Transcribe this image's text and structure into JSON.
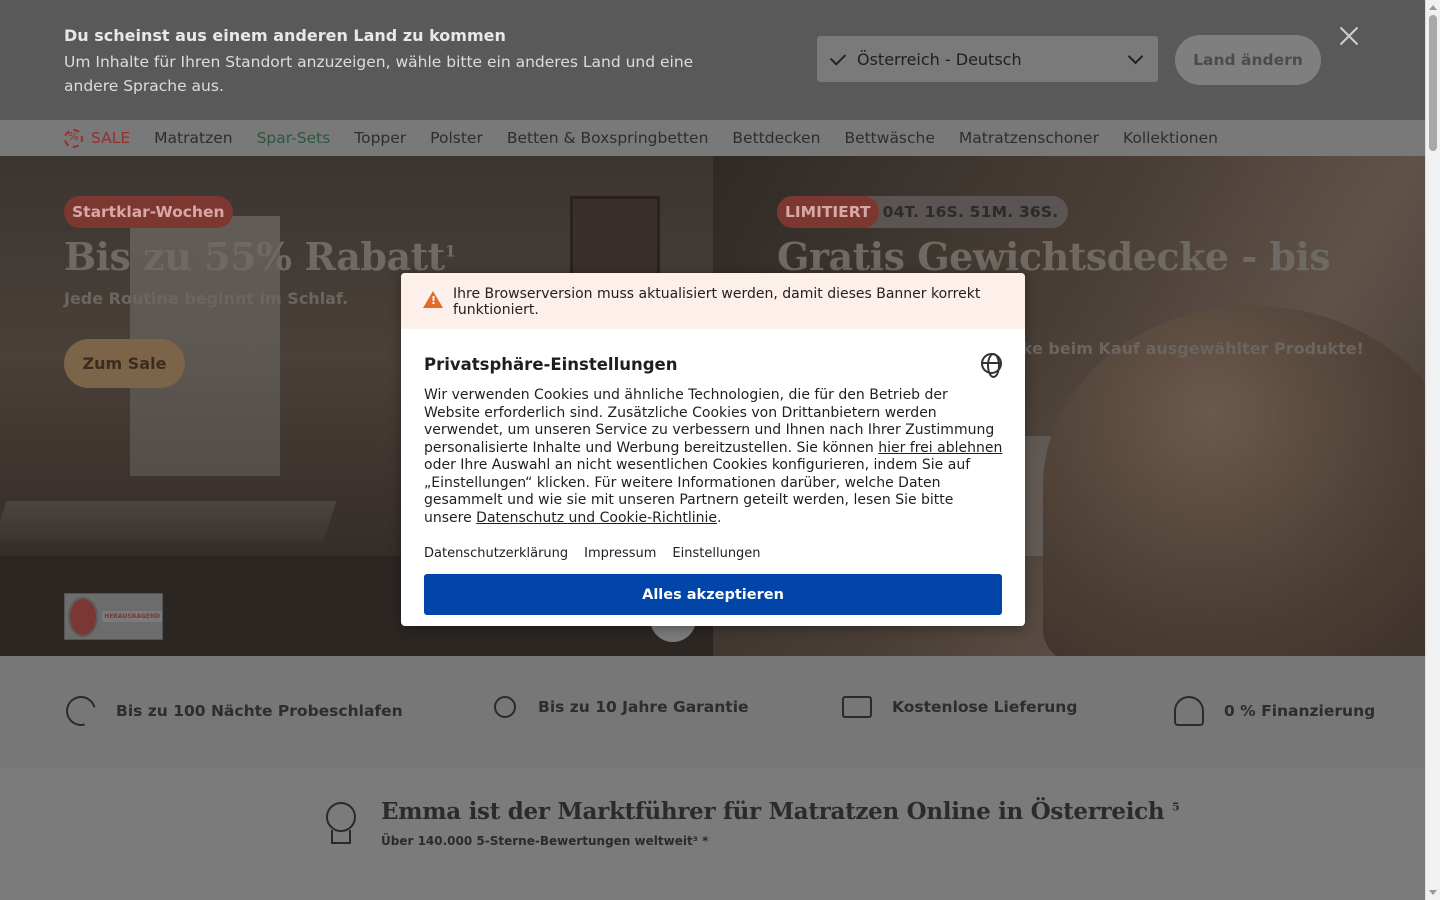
{
  "country_banner": {
    "title": "Du scheinst aus einem anderen Land zu kommen",
    "text": "Um Inhalte für Ihren Standort anzuzeigen, wähle bitte ein anderes Land und eine andere Sprache aus.",
    "selected_country": "Österreich - Deutsch",
    "change_button": "Land ändern"
  },
  "nav": {
    "items": [
      "SALE",
      "Matratzen",
      "Spar-Sets",
      "Topper",
      "Polster",
      "Betten & Boxspringbetten",
      "Bettdecken",
      "Bettwäsche",
      "Matratzenschoner",
      "Kollektionen"
    ]
  },
  "hero": {
    "left": {
      "badge": "Startklar-Wochen",
      "title": "Bis zu 55% Rabatt",
      "title_sup": "1",
      "subtitle": "Jede Routine beginnt im Schlaf.",
      "cta": "Zum Sale",
      "award_tag": "HERAUSRAGEND"
    },
    "right": {
      "badge": "LIMITIERT",
      "countdown": "04T. 16S. 51M. 36S.",
      "title": "Gratis Gewichtsdecke - bis",
      "subtitle": "decke beim Kauf ausgewählter Produkte!"
    }
  },
  "usps": [
    "Bis zu 100 Nächte Probeschlafen",
    "Bis zu 10 Jahre Garantie",
    "Kostenlose Lieferung",
    "0 % Finanzierung"
  ],
  "leader": {
    "title": "Emma ist der Marktführer für Matratzen Online in Österreich",
    "title_sup": "5",
    "subtitle": "Über 140.000 5-Sterne-Bewertungen weltweit³ *"
  },
  "consent": {
    "warning": "Ihre Browserversion muss aktualisiert werden, damit dieses Banner korrekt funktioniert.",
    "title": "Privatsphäre-Einstellungen",
    "body_part1": "Wir verwenden Cookies und ähnliche Technologien, die für den Betrieb der Website erforderlich sind. Zusätzliche Cookies von Drittanbietern werden verwendet, um unseren Service zu verbessern und Ihnen nach Ihrer Zustimmung personalisierte Inhalte und Werbung bereitzustellen. Sie können ",
    "link_reject": "hier frei ablehnen",
    "body_part2": " oder Ihre Auswahl an nicht wesentlichen Cookies konfigurieren, indem Sie auf „Einstellungen“ klicken. Für weitere Informationen darüber, welche Daten gesammelt und wie sie mit unseren Partnern geteilt werden, lesen Sie bitte unsere ",
    "link_policy": "Datenschutz und Cookie-Richtlinie",
    "body_part3": ".",
    "links": [
      "Datenschutzerklärung",
      "Impressum",
      "Einstellungen"
    ],
    "accept_button": "Alles akzeptieren"
  },
  "colors": {
    "accept_blue": "#0045a7",
    "sale_red": "#9b2e2a",
    "overlay_dim": "#595959"
  }
}
